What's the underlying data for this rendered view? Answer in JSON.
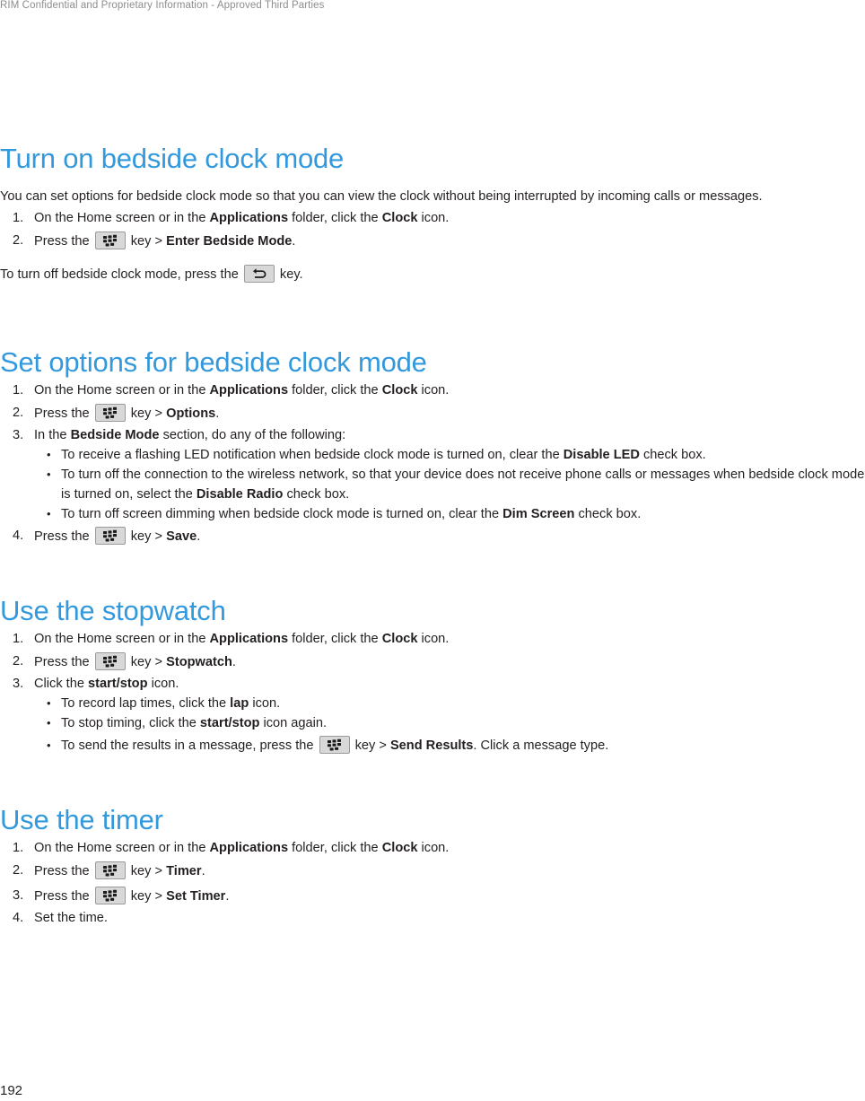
{
  "document": {
    "header": "RIM Confidential and Proprietary Information - Approved Third Parties",
    "page_number": "192",
    "heading_color": "#3399dd",
    "body_color": "#231f20",
    "header_color": "#8d8d90"
  },
  "icons": {
    "menu_key": "blackberry-menu-key-icon",
    "escape_key": "escape-back-key-icon"
  },
  "sections": [
    {
      "id": "turn-on-bedside-clock-mode",
      "title": "Turn on bedside clock mode",
      "intro": "You can set options for bedside clock mode so that you can view the clock without being interrupted by incoming calls or messages.",
      "steps": [
        {
          "parts": [
            {
              "t": "text",
              "v": "On the Home screen or in the "
            },
            {
              "t": "bold",
              "v": "Applications"
            },
            {
              "t": "text",
              "v": " folder, click the "
            },
            {
              "t": "bold",
              "v": "Clock"
            },
            {
              "t": "text",
              "v": " icon."
            }
          ]
        },
        {
          "parts": [
            {
              "t": "text",
              "v": "Press the "
            },
            {
              "t": "key",
              "v": "menu"
            },
            {
              "t": "text",
              "v": " key > "
            },
            {
              "t": "bold",
              "v": "Enter Bedside Mode"
            },
            {
              "t": "text",
              "v": "."
            }
          ]
        }
      ],
      "outro": {
        "parts": [
          {
            "t": "text",
            "v": "To turn off bedside clock mode, press the "
          },
          {
            "t": "key",
            "v": "escape"
          },
          {
            "t": "text",
            "v": " key."
          }
        ]
      }
    },
    {
      "id": "set-options-for-bedside-clock-mode",
      "title": "Set options for bedside clock mode",
      "steps": [
        {
          "parts": [
            {
              "t": "text",
              "v": "On the Home screen or in the "
            },
            {
              "t": "bold",
              "v": "Applications"
            },
            {
              "t": "text",
              "v": " folder, click the "
            },
            {
              "t": "bold",
              "v": "Clock"
            },
            {
              "t": "text",
              "v": " icon."
            }
          ]
        },
        {
          "parts": [
            {
              "t": "text",
              "v": "Press the "
            },
            {
              "t": "key",
              "v": "menu"
            },
            {
              "t": "text",
              "v": " key > "
            },
            {
              "t": "bold",
              "v": "Options"
            },
            {
              "t": "text",
              "v": "."
            }
          ]
        },
        {
          "parts": [
            {
              "t": "text",
              "v": "In the "
            },
            {
              "t": "bold",
              "v": "Bedside Mode"
            },
            {
              "t": "text",
              "v": " section, do any of the following:"
            }
          ],
          "bullets": [
            {
              "parts": [
                {
                  "t": "text",
                  "v": "To receive a flashing LED notification when bedside clock mode is turned on, clear the "
                },
                {
                  "t": "bold",
                  "v": "Disable LED"
                },
                {
                  "t": "text",
                  "v": " check box."
                }
              ]
            },
            {
              "parts": [
                {
                  "t": "text",
                  "v": "To turn off the connection to the wireless network, so that your device does not receive phone calls or messages when bedside clock mode is turned on, select the "
                },
                {
                  "t": "bold",
                  "v": "Disable Radio"
                },
                {
                  "t": "text",
                  "v": " check box."
                }
              ]
            },
            {
              "parts": [
                {
                  "t": "text",
                  "v": "To turn off screen dimming when bedside clock mode is turned on, clear the "
                },
                {
                  "t": "bold",
                  "v": "Dim Screen"
                },
                {
                  "t": "text",
                  "v": " check box."
                }
              ]
            }
          ]
        },
        {
          "parts": [
            {
              "t": "text",
              "v": "Press the "
            },
            {
              "t": "key",
              "v": "menu"
            },
            {
              "t": "text",
              "v": " key > "
            },
            {
              "t": "bold",
              "v": "Save"
            },
            {
              "t": "text",
              "v": "."
            }
          ]
        }
      ]
    },
    {
      "id": "use-the-stopwatch",
      "title": "Use the stopwatch",
      "steps": [
        {
          "parts": [
            {
              "t": "text",
              "v": "On the Home screen or in the "
            },
            {
              "t": "bold",
              "v": "Applications"
            },
            {
              "t": "text",
              "v": " folder, click the "
            },
            {
              "t": "bold",
              "v": "Clock"
            },
            {
              "t": "text",
              "v": " icon."
            }
          ]
        },
        {
          "parts": [
            {
              "t": "text",
              "v": "Press the "
            },
            {
              "t": "key",
              "v": "menu"
            },
            {
              "t": "text",
              "v": " key > "
            },
            {
              "t": "bold",
              "v": "Stopwatch"
            },
            {
              "t": "text",
              "v": "."
            }
          ]
        },
        {
          "parts": [
            {
              "t": "text",
              "v": "Click the "
            },
            {
              "t": "bold",
              "v": "start/stop"
            },
            {
              "t": "text",
              "v": " icon."
            }
          ],
          "bullets": [
            {
              "parts": [
                {
                  "t": "text",
                  "v": "To record lap times, click the "
                },
                {
                  "t": "bold",
                  "v": "lap"
                },
                {
                  "t": "text",
                  "v": " icon."
                }
              ]
            },
            {
              "parts": [
                {
                  "t": "text",
                  "v": "To stop timing, click the "
                },
                {
                  "t": "bold",
                  "v": "start/stop"
                },
                {
                  "t": "text",
                  "v": " icon again."
                }
              ]
            },
            {
              "parts": [
                {
                  "t": "text",
                  "v": "To send the results in a message, press the "
                },
                {
                  "t": "key",
                  "v": "menu"
                },
                {
                  "t": "text",
                  "v": " key > "
                },
                {
                  "t": "bold",
                  "v": "Send Results"
                },
                {
                  "t": "text",
                  "v": ". Click a message type."
                }
              ]
            }
          ]
        }
      ]
    },
    {
      "id": "use-the-timer",
      "title": "Use the timer",
      "steps": [
        {
          "parts": [
            {
              "t": "text",
              "v": "On the Home screen or in the "
            },
            {
              "t": "bold",
              "v": "Applications"
            },
            {
              "t": "text",
              "v": " folder, click the "
            },
            {
              "t": "bold",
              "v": "Clock"
            },
            {
              "t": "text",
              "v": " icon."
            }
          ]
        },
        {
          "parts": [
            {
              "t": "text",
              "v": "Press the "
            },
            {
              "t": "key",
              "v": "menu"
            },
            {
              "t": "text",
              "v": " key > "
            },
            {
              "t": "bold",
              "v": "Timer"
            },
            {
              "t": "text",
              "v": "."
            }
          ]
        },
        {
          "parts": [
            {
              "t": "text",
              "v": "Press the "
            },
            {
              "t": "key",
              "v": "menu"
            },
            {
              "t": "text",
              "v": " key > "
            },
            {
              "t": "bold",
              "v": "Set Timer"
            },
            {
              "t": "text",
              "v": "."
            }
          ]
        },
        {
          "parts": [
            {
              "t": "text",
              "v": "Set the time."
            }
          ]
        }
      ]
    }
  ]
}
